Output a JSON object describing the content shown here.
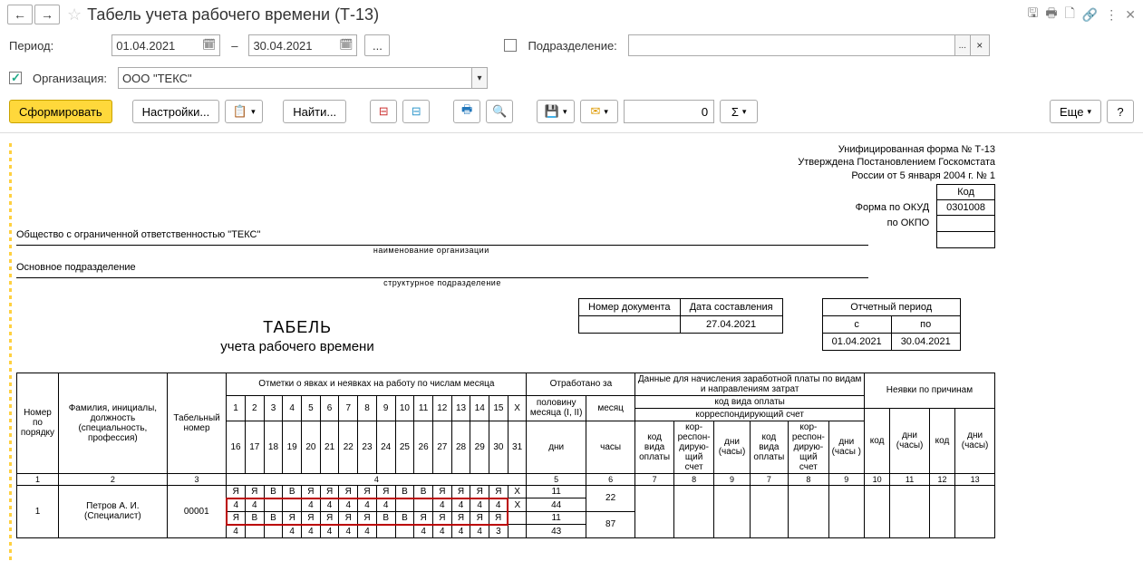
{
  "title": "Табель учета рабочего времени (Т-13)",
  "period_label": "Период:",
  "date_from": "01.04.2021",
  "date_to": "30.04.2021",
  "org_label": "Организация:",
  "org_value": "ООО \"ТЕКС\"",
  "dept_label": "Подразделение:",
  "dept_value": "",
  "toolbar": {
    "generate": "Сформировать",
    "settings": "Настройки...",
    "find": "Найти...",
    "more": "Еще",
    "num": "0"
  },
  "report": {
    "form_name": "Унифицированная форма № Т-13",
    "decree1": "Утверждена Постановлением Госкомстата",
    "decree2": "России от 5 января 2004 г. № 1",
    "code_header": "Код",
    "okud_lbl": "Форма по ОКУД",
    "okud": "0301008",
    "okpo_lbl": "по ОКПО",
    "org_full": "Общество с ограниченной ответственностью \"ТЕКС\"",
    "org_cap": "наименование организации",
    "dept": "Основное подразделение",
    "dept_cap": "структурное подразделение",
    "doc_num_h": "Номер документа",
    "doc_date_h": "Дата составления",
    "doc_num": "",
    "doc_date": "27.04.2021",
    "rep_period_h": "Отчетный период",
    "rep_from_h": "с",
    "rep_to_h": "по",
    "rep_from": "01.04.2021",
    "rep_to": "30.04.2021",
    "title": "ТАБЕЛЬ",
    "subtitle": "учета   рабочего времени",
    "h": {
      "npp": "Номер по порядку",
      "fio": "Фамилия, инициалы, должность (специальность, профессия)",
      "tabnum": "Табельный номер",
      "marks": "Отметки о явках и неявках на работу по числам месяца",
      "worked": "Отработано за",
      "halfmonth": "половину месяца (I, II)",
      "month": "месяц",
      "days": "дни",
      "hours": "часы",
      "salary_data": "Данные для начисления заработной платы по видам и направлениям затрат",
      "pay_code_hdr": "код вида оплаты",
      "corr_acc_hdr": "корреспондирующий счет",
      "pay_code": "код вида оплаты",
      "corr_acc": "кор-респон-дирую-щий счет",
      "days_hours": "дни (часы)",
      "days_hours2": "дни (часы )",
      "absence": "Неявки по причинам",
      "kod": "код",
      "x": "X"
    },
    "days_top": [
      "1",
      "2",
      "3",
      "4",
      "5",
      "6",
      "7",
      "8",
      "9",
      "10",
      "11",
      "12",
      "13",
      "14",
      "15",
      "X"
    ],
    "days_bot": [
      "16",
      "17",
      "18",
      "19",
      "20",
      "21",
      "22",
      "23",
      "24",
      "25",
      "26",
      "27",
      "28",
      "29",
      "30",
      "31"
    ],
    "colnums": {
      "c1": "1",
      "c2": "2",
      "c3": "3",
      "c4": "4",
      "c5": "5",
      "c6": "6",
      "c7": "7",
      "c8": "8",
      "c9": "9",
      "c10": "10",
      "c11": "11",
      "c12": "12",
      "c13": "13"
    },
    "row1": {
      "npp": "1",
      "fio": "Петров А. И. (Специалист)",
      "tabnum": "00001",
      "line1": [
        "Я",
        "Я",
        "В",
        "В",
        "Я",
        "Я",
        "Я",
        "Я",
        "Я",
        "В",
        "В",
        "Я",
        "Я",
        "Я",
        "Я",
        "X"
      ],
      "line2": [
        "4",
        "4",
        "",
        "",
        "4",
        "4",
        "4",
        "4",
        "4",
        "",
        "",
        "4",
        "4",
        "4",
        "4",
        "X"
      ],
      "line3": [
        "Я",
        "В",
        "В",
        "Я",
        "Я",
        "Я",
        "Я",
        "Я",
        "В",
        "В",
        "Я",
        "Я",
        "Я",
        "Я",
        "Я",
        ""
      ],
      "line4": [
        "4",
        "",
        "",
        "4",
        "4",
        "4",
        "4",
        "4",
        "",
        "",
        "4",
        "4",
        "4",
        "4",
        "3",
        ""
      ],
      "half_days1": "11",
      "half_hours1": "44",
      "half_days2": "11",
      "half_hours2": "43",
      "month_days": "22",
      "month_hours": "87"
    }
  }
}
